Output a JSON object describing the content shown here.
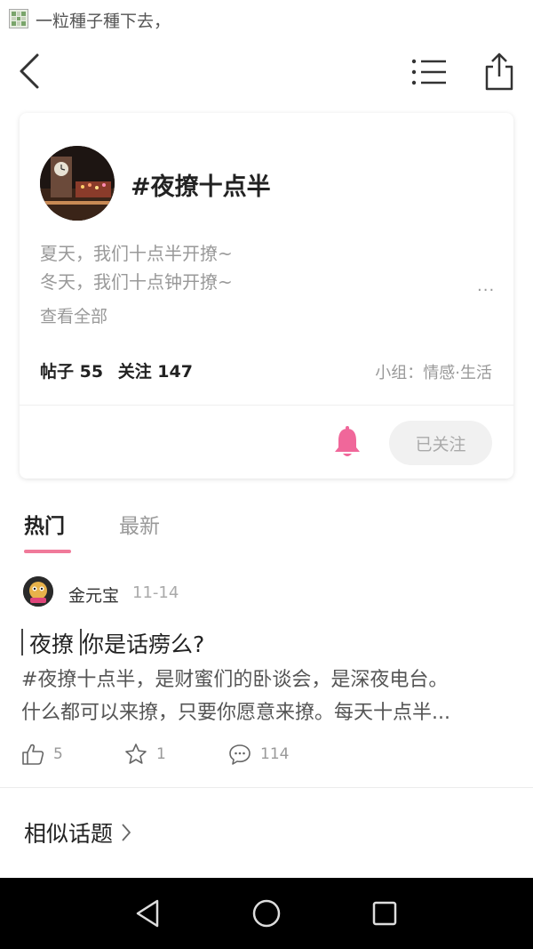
{
  "status_bar": {
    "title": "一粒種子種下去，"
  },
  "nav": {
    "back_icon": "chevron-left-icon",
    "menu_icon": "list-icon",
    "share_icon": "share-icon"
  },
  "topic": {
    "title": "#夜撩十点半",
    "description_lines": [
      "夏天，我们十点半开撩~",
      "冬天，我们十点钟开撩~"
    ],
    "more": "...",
    "see_all": "查看全部",
    "posts_label": "帖子 55",
    "followers_label": "关注 147",
    "group": "小组：情感·生活",
    "follow_button": "已关注",
    "accent_color": "#f0679a"
  },
  "tabs": [
    {
      "label": "热门",
      "active": true
    },
    {
      "label": "最新",
      "active": false
    }
  ],
  "post": {
    "author": "金元宝",
    "date": "11-14",
    "tag": "夜撩",
    "title": "你是话痨么?",
    "body_lines": [
      "#夜撩十点半，是财蜜们的卧谈会，是深夜电台。",
      "什么都可以来撩，只要你愿意来撩。每天十点半..."
    ],
    "likes": "5",
    "favorites": "1",
    "comments": "114"
  },
  "similar": {
    "label": "相似话题"
  },
  "system_nav": {
    "back_icon": "triangle-back-icon",
    "home_icon": "circle-home-icon",
    "recent_icon": "square-recent-icon"
  }
}
